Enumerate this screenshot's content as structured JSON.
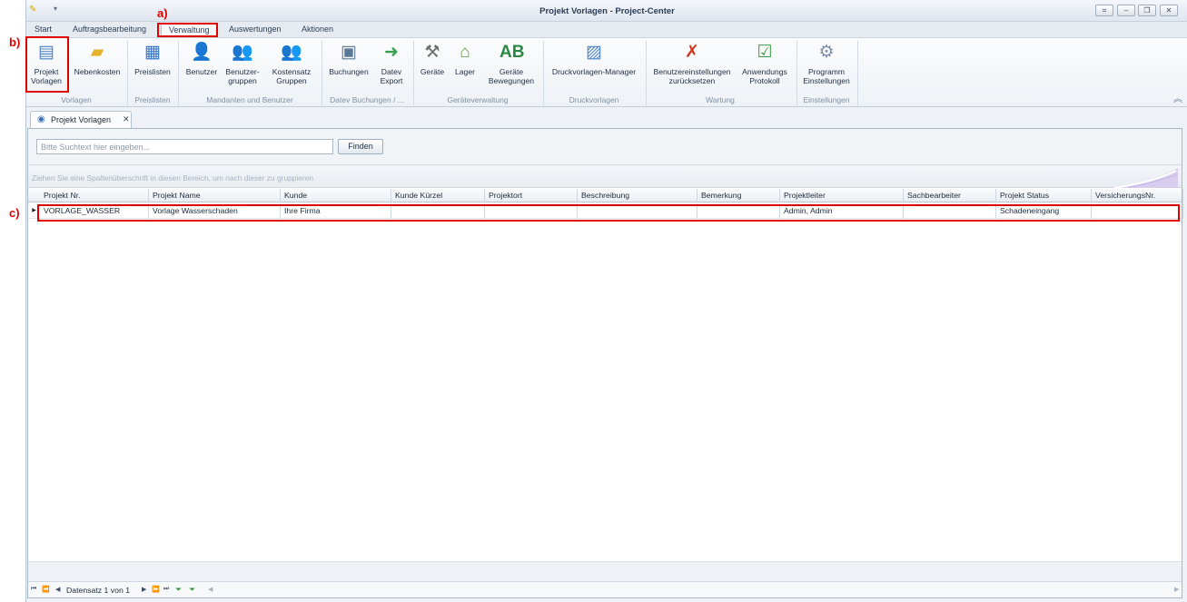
{
  "window": {
    "title_prefix": "Projekt Vorlagen - ",
    "title_app": "Project-Center",
    "quick_access": [
      "app-icon",
      "dropdown-arrow"
    ],
    "controls": [
      "restore-icon",
      "minimize-icon",
      "maximize-icon",
      "close-icon"
    ]
  },
  "ribbon_tabs": [
    "Start",
    "Auftragsbearbeitung",
    "Verwaltung",
    "Auswertungen",
    "Aktionen"
  ],
  "active_tab": "Verwaltung",
  "ribbon": {
    "buttons": {
      "projekt_vorlagen": [
        "Projekt",
        "Vorlagen"
      ],
      "nebenkosten": [
        "Nebenkosten"
      ],
      "preislisten": [
        "Preislisten"
      ],
      "benutzer": [
        "Benutzer"
      ],
      "benutzergruppen": [
        "Benutzer-",
        "gruppen"
      ],
      "kostensatz_gruppen": [
        "Kostensatz",
        "Gruppen"
      ],
      "buchungen": [
        "Buchungen"
      ],
      "datev_export": [
        "Datev",
        "Export"
      ],
      "geraete": [
        "Geräte"
      ],
      "lager": [
        "Lager"
      ],
      "geraete_bewegungen": [
        "Geräte",
        "Bewegungen"
      ],
      "druckvorlagen_manager": [
        "Druckvorlagen-Manager"
      ],
      "benutzereinstellungen": [
        "Benutzereinstellungen",
        "zurücksetzen"
      ],
      "anwendungs_protokoll": [
        "Anwendungs",
        "Protokoll"
      ],
      "programm_einstellungen": [
        "Programm",
        "Einstellungen"
      ]
    },
    "groups": {
      "vorlagen": "Vorlagen",
      "preislisten": "Preislisten",
      "mandanten": "Mandanten und Benutzer",
      "datev": "Datev Buchungen / ...",
      "geraete": "Geräteverwaltung",
      "druck": "Druckvorlagen",
      "wartung": "Wartung",
      "einstellungen": "Einstellungen"
    }
  },
  "document_tab": {
    "label": "Projekt Vorlagen",
    "close": "✕"
  },
  "search": {
    "placeholder": "Bitte Suchtext hier eingeben...",
    "value": "",
    "button": "Finden"
  },
  "group_hint": "Ziehen Sie eine Spaltenüberschrift in diesen Bereich, um nach dieser zu gruppieren",
  "grid": {
    "columns": [
      "Projekt Nr.",
      "Projekt Name",
      "Kunde",
      "Kunde Kürzel",
      "Projektort",
      "Beschreibung",
      "Bemerkung",
      "Projektleiter",
      "Sachbearbeiter",
      "Projekt Status",
      "VersicherungsNr."
    ],
    "rows": [
      [
        "VORLAGE_WASSER",
        "Vorlage Wasserschaden",
        "Ihre Firma",
        "",
        "",
        "",
        "",
        "Admin, Admin",
        "",
        "Schadeneingang",
        ""
      ]
    ]
  },
  "navigator": {
    "record_text": "Datensatz 1 von 1"
  },
  "annotations": {
    "a": "a)",
    "b": "b)",
    "c": "c)"
  },
  "colors": {
    "annotation": "#e00000",
    "accent": "#3d6fb3"
  }
}
